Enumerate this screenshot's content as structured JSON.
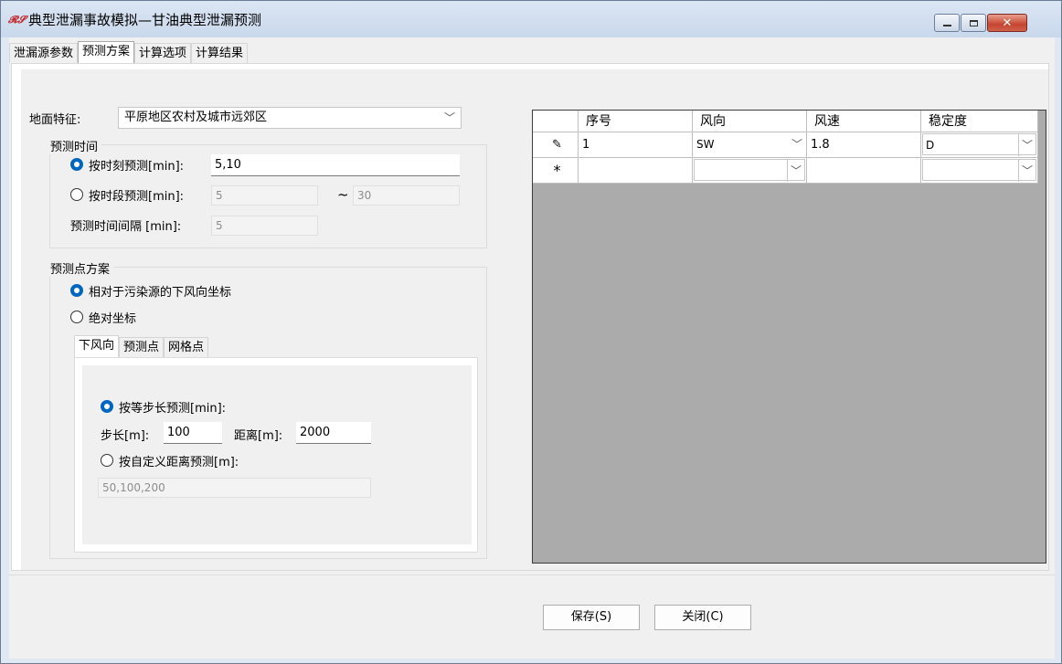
{
  "window": {
    "title": "典型泄漏事故模拟—甘油典型泄漏预测",
    "icon": "app-logo-icon",
    "icon_text": "𝓡𝓢"
  },
  "tabs": [
    {
      "label": "泄漏源参数",
      "active": false
    },
    {
      "label": "预测方案",
      "active": true
    },
    {
      "label": "计算选项",
      "active": false
    },
    {
      "label": "计算结果",
      "active": false
    }
  ],
  "ground": {
    "label": "地面特征:",
    "value": "平原地区农村及城市远郊区"
  },
  "time_group": {
    "title": "预测时间",
    "by_moment_label": "按时刻预测[min]:",
    "by_moment_value": "5,10",
    "by_period_label": "按时段预测[min]:",
    "period_from": "5",
    "tilde": "~",
    "period_to": "30",
    "interval_label": "预测时间间隔 [min]:",
    "interval_value": "5"
  },
  "point_group": {
    "title": "预测点方案",
    "relative_label": "相对于污染源的下风向坐标",
    "absolute_label": "绝对坐标",
    "subtabs": [
      "下风向",
      "预测点",
      "网格点"
    ],
    "equal_step_label": "按等步长预测[min]:",
    "step_label": "步长[m]:",
    "step_value": "100",
    "distance_label": "距离[m]:",
    "distance_value": "2000",
    "custom_label": "按自定义距离预测[m]:",
    "custom_value": "50,100,200"
  },
  "grid": {
    "columns": [
      "序号",
      "风向",
      "风速",
      "稳定度"
    ],
    "rows": [
      {
        "marker": "✎",
        "seq": "1",
        "direction": "SW",
        "speed": "1.8",
        "stability": "D"
      },
      {
        "marker": "*",
        "seq": "",
        "direction": "",
        "speed": "",
        "stability": ""
      }
    ]
  },
  "buttons": {
    "save": "保存(S)",
    "close": "关闭(C)"
  }
}
